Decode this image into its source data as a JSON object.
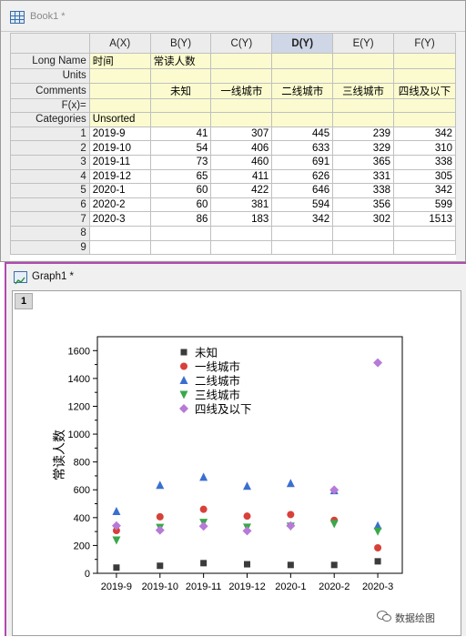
{
  "book": {
    "title": "Book1 *",
    "column_headers": [
      "A(X)",
      "B(Y)",
      "C(Y)",
      "D(Y)",
      "E(Y)",
      "F(Y)"
    ],
    "selected_column": 3,
    "meta_rows": [
      {
        "label": "Long Name",
        "cells": [
          "时间",
          "常读人数",
          "",
          "",
          "",
          ""
        ]
      },
      {
        "label": "Units",
        "cells": [
          "",
          "",
          "",
          "",
          "",
          ""
        ]
      },
      {
        "label": "Comments",
        "cells": [
          "",
          "未知",
          "一线城市",
          "二线城市",
          "三线城市",
          "四线及以下"
        ]
      },
      {
        "label": "F(x)=",
        "cells": [
          "",
          "",
          "",
          "",
          "",
          ""
        ]
      },
      {
        "label": "Categories",
        "cells": [
          "Unsorted",
          "",
          "",
          "",
          "",
          ""
        ]
      }
    ],
    "data_rows": [
      {
        "n": "1",
        "cells": [
          "2019-9",
          "41",
          "307",
          "445",
          "239",
          "342"
        ]
      },
      {
        "n": "2",
        "cells": [
          "2019-10",
          "54",
          "406",
          "633",
          "329",
          "310"
        ]
      },
      {
        "n": "3",
        "cells": [
          "2019-11",
          "73",
          "460",
          "691",
          "365",
          "338"
        ]
      },
      {
        "n": "4",
        "cells": [
          "2019-12",
          "65",
          "411",
          "626",
          "331",
          "305"
        ]
      },
      {
        "n": "5",
        "cells": [
          "2020-1",
          "60",
          "422",
          "646",
          "338",
          "342"
        ]
      },
      {
        "n": "6",
        "cells": [
          "2020-2",
          "60",
          "381",
          "594",
          "356",
          "599"
        ]
      },
      {
        "n": "7",
        "cells": [
          "2020-3",
          "86",
          "183",
          "342",
          "302",
          "1513"
        ]
      },
      {
        "n": "8",
        "cells": [
          "",
          "",
          "",
          "",
          "",
          ""
        ]
      },
      {
        "n": "9",
        "cells": [
          "",
          "",
          "",
          "",
          "",
          ""
        ]
      }
    ]
  },
  "graph": {
    "title": "Graph1 *",
    "layer_label": "1"
  },
  "watermark": "数据绘图",
  "chart_data": {
    "type": "scatter",
    "categories": [
      "2019-9",
      "2019-10",
      "2019-11",
      "2019-12",
      "2020-1",
      "2020-2",
      "2020-3"
    ],
    "ylabel": "常读人数",
    "xlabel": "",
    "ylim": [
      0,
      1700
    ],
    "yticks": [
      0,
      200,
      400,
      600,
      800,
      1000,
      1200,
      1400,
      1600
    ],
    "legend_position": "top-left",
    "grid": false,
    "series": [
      {
        "name": "未知",
        "marker": "square",
        "color": "#3b3b3b",
        "values": [
          41,
          54,
          73,
          65,
          60,
          60,
          86
        ]
      },
      {
        "name": "一线城市",
        "marker": "circle",
        "color": "#d8403a",
        "values": [
          307,
          406,
          460,
          411,
          422,
          381,
          183
        ]
      },
      {
        "name": "二线城市",
        "marker": "triangle-up",
        "color": "#3a6fd0",
        "values": [
          445,
          633,
          691,
          626,
          646,
          594,
          342
        ]
      },
      {
        "name": "三线城市",
        "marker": "triangle-down",
        "color": "#3aa84a",
        "values": [
          239,
          329,
          365,
          331,
          338,
          356,
          302
        ]
      },
      {
        "name": "四线及以下",
        "marker": "diamond",
        "color": "#b77ad8",
        "values": [
          342,
          310,
          338,
          305,
          342,
          599,
          1513
        ]
      }
    ]
  }
}
